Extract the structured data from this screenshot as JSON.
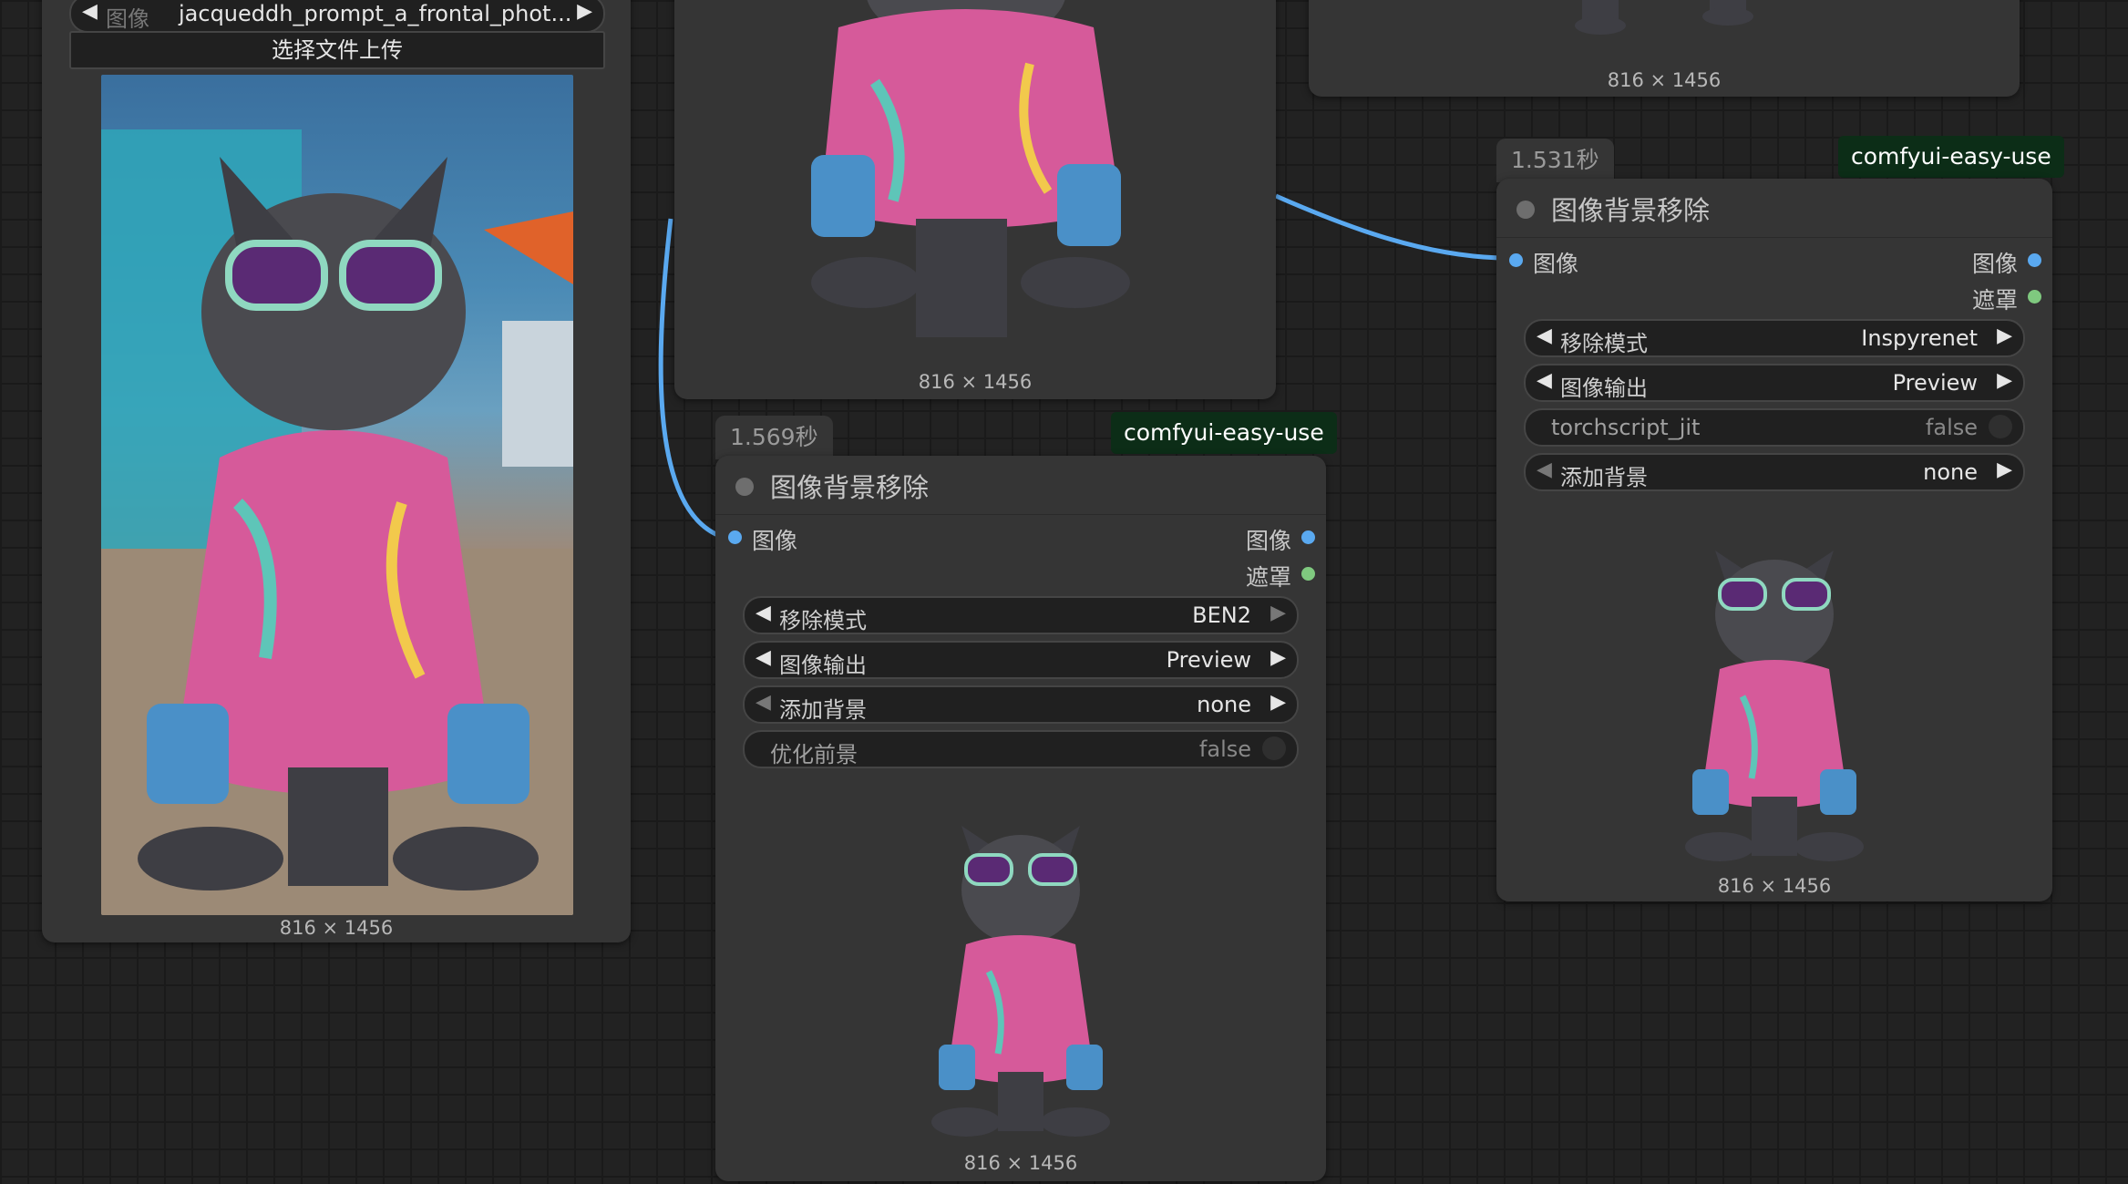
{
  "load_node": {
    "image_label": "图像",
    "image_value": "jacqueddh_prompt_a_frontal_phot...",
    "upload_button": "选择文件上传",
    "dims": "816 × 1456"
  },
  "top_middle_preview": {
    "dims": "816 × 1456"
  },
  "top_right_preview": {
    "dims": "816 × 1456"
  },
  "node_mid": {
    "timing": "1.569秒",
    "badge": "comfyui-easy-use",
    "title": "图像背景移除",
    "input_label": "图像",
    "output_image": "图像",
    "output_mask": "遮罩",
    "widgets": {
      "mode_label": "移除模式",
      "mode_value": "BEN2",
      "output_label": "图像输出",
      "output_value": "Preview",
      "bg_label": "添加背景",
      "bg_value": "none",
      "refine_label": "优化前景",
      "refine_value": "false"
    },
    "dims": "816 × 1456"
  },
  "node_right": {
    "timing": "1.531秒",
    "badge": "comfyui-easy-use",
    "title": "图像背景移除",
    "input_label": "图像",
    "output_image": "图像",
    "output_mask": "遮罩",
    "widgets": {
      "mode_label": "移除模式",
      "mode_value": "Inspyrenet",
      "output_label": "图像输出",
      "output_value": "Preview",
      "jit_label": "torchscript_jit",
      "jit_value": "false",
      "bg_label": "添加背景",
      "bg_value": "none"
    },
    "dims": "816 × 1456"
  },
  "colors": {
    "image_port": "#5aa9f0",
    "mask_port": "#7fc97f",
    "link": "#5aa9f0",
    "badge_bg": "#0c2d17"
  },
  "arrows": {
    "left": "◀",
    "right": "▶"
  }
}
